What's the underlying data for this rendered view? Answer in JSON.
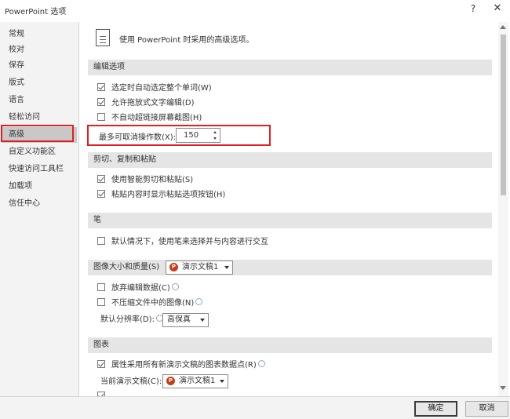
{
  "window": {
    "title": "PowerPoint 选项",
    "help": "?",
    "close": "✕"
  },
  "sidebar": {
    "items": [
      {
        "label": "常规"
      },
      {
        "label": "校对"
      },
      {
        "label": "保存"
      },
      {
        "label": "版式"
      },
      {
        "label": "语言"
      },
      {
        "label": "轻松访问"
      },
      {
        "label": "高级"
      },
      {
        "label": "自定义功能区"
      },
      {
        "label": "快速访问工具栏"
      },
      {
        "label": "加载项"
      },
      {
        "label": "信任中心"
      }
    ],
    "active_index": 6
  },
  "intro": {
    "text": "使用 PowerPoint 时采用的高级选项。"
  },
  "sections": {
    "editing": {
      "header": "编辑选项",
      "options": [
        {
          "label": "选定时自动选定整个单词(W)",
          "checked": true
        },
        {
          "label": "允许拖放式文字编辑(D)",
          "checked": true
        },
        {
          "label": "不自动超链接屏幕截图(H)",
          "checked": false
        }
      ],
      "undo_label": "最多可取消操作数(X):",
      "undo_value": "150"
    },
    "cut_paste": {
      "header": "剪切、复制和粘贴",
      "options": [
        {
          "label": "使用智能剪切和粘贴(S)",
          "checked": true
        },
        {
          "label": "粘贴内容时显示粘贴选项按钮(H)",
          "checked": true
        }
      ]
    },
    "pen": {
      "header": "笔",
      "options": [
        {
          "label": "默认情况下，使用笔来选择并与内容进行交互",
          "checked": false
        }
      ]
    },
    "image_size": {
      "header": "图像大小和质量(S)",
      "select_value": "演示文稿1",
      "options": [
        {
          "label": "放弃编辑数据(C)",
          "checked": false
        },
        {
          "label": "不压缩文件中的图像(N)",
          "checked": false
        }
      ],
      "resolution_label": "默认分辨率(D):",
      "resolution_value": "高保真"
    },
    "chart": {
      "header": "图表",
      "options": [
        {
          "label": "属性采用所有新演示文稿的图表数据点(R)",
          "checked": true
        }
      ],
      "current_label": "当前演示文稿(C):",
      "current_value": "演示文稿1"
    }
  },
  "buttons": {
    "ok": "确定",
    "cancel": "取消"
  },
  "colors": {
    "highlight_red": "#e02020",
    "section_bg": "#e5e5e5",
    "sidebar_bg": "#f3f3f3",
    "active_item_bg": "#c8c8c8",
    "powerpoint_orange": "#c43e1c"
  }
}
